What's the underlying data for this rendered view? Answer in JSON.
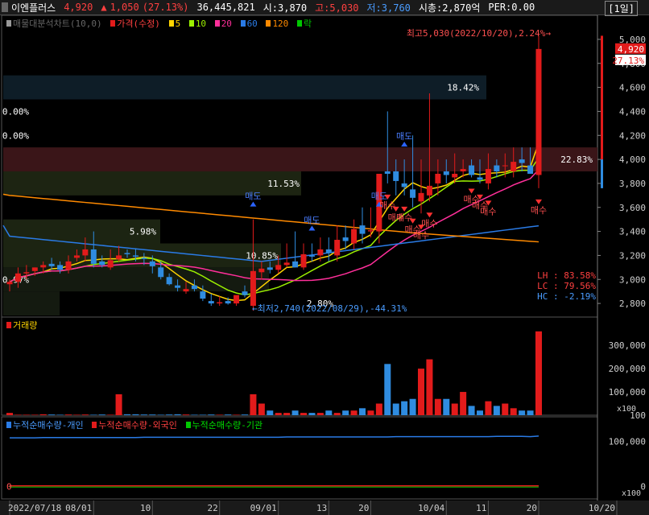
{
  "header": {
    "name": "이엔플러스",
    "price": "4,920",
    "change_arrow": "▲",
    "change": "1,050",
    "change_pct": "(27.13%)",
    "volume": "36,445,821",
    "open": "시:3,870",
    "high": "고:5,030",
    "low": "저:3,760",
    "mcap": "시총:2,870억",
    "per": "PER:0.00",
    "timeframe": "[1일]"
  },
  "price_legend": {
    "profile": "매물대분석차트(10,0)",
    "price_label": "가격(수정)",
    "ma": [
      "5",
      "10",
      "20",
      "60",
      "120",
      "락"
    ]
  },
  "volume_legend": "거래량",
  "flow_legend": [
    "누적순매수량-개인",
    "누적순매수량-외국인",
    "누적순매수량-기관"
  ],
  "annotations": {
    "high": "최고5,030(2022/10/20),2.24%→",
    "low": "←최저2,740(2022/08/29),-44.31%",
    "lh": "LH : 83.58%",
    "lc": "LC : 79.56%",
    "hc": "HC : -2.19%",
    "current_price": "4,920",
    "current_pct": "27.13%",
    "flow_zero": "0",
    "flow_unit": "x100",
    "vol_unit": "x100",
    "buy": "매수",
    "sell": "매도"
  },
  "profile_zones": [
    {
      "low": 4500,
      "high": 4700,
      "pct": "18.42%"
    },
    {
      "low": 4100,
      "high": 4300,
      "pct": "0.00%"
    },
    {
      "low": 4300,
      "high": 4500,
      "pct": "0.00%"
    },
    {
      "low": 3700,
      "high": 3900,
      "pct": "11.53%"
    },
    {
      "low": 3900,
      "high": 4100,
      "pct": "22.83%"
    },
    {
      "low": 3300,
      "high": 3500,
      "pct": "5.98%"
    },
    {
      "low": 3100,
      "high": 3300,
      "pct": "10.85%"
    },
    {
      "low": 2900,
      "high": 3100,
      "pct": "0.97%"
    },
    {
      "low": 2700,
      "high": 2900,
      "pct": "2.80%"
    }
  ],
  "chart_data": {
    "type": "candlestick",
    "dates": [
      "2022/07/18",
      "2022/07/19",
      "2022/07/20",
      "2022/07/21",
      "2022/07/22",
      "2022/07/25",
      "2022/07/26",
      "2022/07/27",
      "2022/07/28",
      "2022/07/29",
      "2022/08/01",
      "2022/08/02",
      "2022/08/03",
      "2022/08/04",
      "2022/08/05",
      "2022/08/08",
      "2022/08/09",
      "2022/08/10",
      "2022/08/11",
      "2022/08/12",
      "2022/08/16",
      "2022/08/17",
      "2022/08/18",
      "2022/08/19",
      "2022/08/22",
      "2022/08/23",
      "2022/08/24",
      "2022/08/25",
      "2022/08/26",
      "2022/08/29",
      "2022/08/30",
      "2022/08/31",
      "2022/09/01",
      "2022/09/02",
      "2022/09/05",
      "2022/09/06",
      "2022/09/07",
      "2022/09/08",
      "2022/09/13",
      "2022/09/14",
      "2022/09/15",
      "2022/09/16",
      "2022/09/19",
      "2022/09/20",
      "2022/09/21",
      "2022/09/22",
      "2022/09/23",
      "2022/09/26",
      "2022/09/27",
      "2022/09/28",
      "2022/09/29",
      "2022/09/30",
      "2022/10/04",
      "2022/10/05",
      "2022/10/06",
      "2022/10/07",
      "2022/10/11",
      "2022/10/12",
      "2022/10/13",
      "2022/10/14",
      "2022/10/17",
      "2022/10/18",
      "2022/10/19",
      "2022/10/20"
    ],
    "open": [
      2960,
      2980,
      3050,
      3070,
      3100,
      3130,
      3120,
      3080,
      3180,
      3200,
      3250,
      3150,
      3100,
      3170,
      3220,
      3200,
      3180,
      3150,
      3100,
      3020,
      2950,
      2900,
      2950,
      2900,
      2820,
      2800,
      2820,
      2800,
      2900,
      2780,
      3060,
      3100,
      3080,
      3120,
      3150,
      3100,
      3200,
      3200,
      3250,
      3200,
      3350,
      3300,
      3450,
      3400,
      3400,
      3900,
      3900,
      3800,
      3750,
      3650,
      3700,
      3800,
      3900,
      3850,
      3900,
      3950,
      3850,
      3800,
      3950,
      3950,
      3900,
      4000,
      3950,
      3870
    ],
    "high": [
      3000,
      3100,
      3120,
      3100,
      3150,
      3180,
      3150,
      3200,
      3250,
      3350,
      3400,
      3200,
      3250,
      3280,
      3250,
      3260,
      3220,
      3200,
      3150,
      3050,
      3000,
      2980,
      3000,
      2950,
      2880,
      2860,
      2850,
      2860,
      2950,
      3500,
      3150,
      3150,
      3200,
      3300,
      3400,
      3300,
      3300,
      3350,
      3350,
      3450,
      3450,
      3500,
      3600,
      3600,
      3500,
      4400,
      4000,
      4000,
      4200,
      4000,
      4550,
      4000,
      4000,
      4050,
      4000,
      4000,
      4000,
      4050,
      4000,
      4050,
      4100,
      4100,
      4100,
      5030
    ],
    "low": [
      2900,
      2930,
      3000,
      3030,
      3050,
      3080,
      3050,
      3050,
      3150,
      3150,
      3100,
      3100,
      3080,
      3150,
      3180,
      3150,
      3120,
      3050,
      3000,
      2950,
      2900,
      2880,
      2900,
      2820,
      2780,
      2780,
      2790,
      2780,
      2850,
      2740,
      3000,
      3050,
      3050,
      3100,
      3100,
      3080,
      3150,
      3150,
      3150,
      3150,
      3250,
      3250,
      3300,
      3350,
      3300,
      3800,
      3700,
      3700,
      3600,
      3550,
      3650,
      3700,
      3800,
      3800,
      3850,
      3850,
      3800,
      3750,
      3850,
      3850,
      3850,
      3900,
      3900,
      3760
    ],
    "close": [
      2980,
      3050,
      3060,
      3100,
      3120,
      3110,
      3080,
      3150,
      3200,
      3250,
      3130,
      3120,
      3160,
      3200,
      3210,
      3190,
      3170,
      3110,
      3020,
      2960,
      2930,
      2920,
      2920,
      2840,
      2800,
      2810,
      2800,
      2870,
      2870,
      3070,
      3090,
      3080,
      3120,
      3140,
      3100,
      3210,
      3190,
      3250,
      3220,
      3330,
      3320,
      3420,
      3380,
      3410,
      3880,
      3880,
      3820,
      3770,
      3680,
      3720,
      3780,
      3880,
      3870,
      3880,
      3920,
      3870,
      3830,
      3920,
      3900,
      3950,
      3980,
      3970,
      3880,
      4920
    ],
    "volume": [
      100,
      20,
      20,
      20,
      40,
      30,
      20,
      30,
      20,
      30,
      20,
      30,
      20,
      900,
      40,
      40,
      30,
      30,
      20,
      30,
      40,
      30,
      20,
      20,
      30,
      20,
      30,
      20,
      30,
      900,
      500,
      200,
      100,
      100,
      200,
      100,
      100,
      100,
      200,
      100,
      200,
      200,
      300,
      200,
      500,
      2200,
      500,
      600,
      700,
      2000,
      2400,
      700,
      700,
      500,
      1000,
      400,
      200,
      600,
      400,
      500,
      300,
      200,
      200,
      3600
    ],
    "flow_individual": [
      162,
      162,
      162,
      162,
      163,
      163,
      163,
      163,
      163,
      163,
      163,
      163,
      163,
      163,
      163,
      163,
      164,
      164,
      164,
      164,
      164,
      164,
      164,
      164,
      164,
      164,
      164,
      164,
      164,
      164,
      164,
      164,
      164,
      165,
      165,
      165,
      165,
      165,
      165,
      165,
      165,
      165,
      165,
      165,
      165,
      165,
      166,
      166,
      166,
      166,
      166,
      166,
      166,
      166,
      166,
      166,
      166,
      166,
      167,
      167,
      167,
      167,
      166,
      168
    ],
    "flow_foreign": [
      2,
      2,
      2,
      2,
      2,
      2,
      2,
      2,
      2,
      2,
      2,
      2,
      2,
      2,
      2,
      2,
      2,
      2,
      2,
      2,
      2,
      2,
      2,
      2,
      2,
      2,
      2,
      2,
      2,
      2,
      2,
      2,
      2,
      2,
      2,
      2,
      2,
      2,
      2,
      2,
      2,
      2,
      2,
      2,
      2,
      2,
      2,
      2,
      2,
      2,
      2,
      2,
      2,
      2,
      2,
      2,
      2,
      2,
      2,
      2,
      2,
      2,
      2,
      2
    ],
    "flow_institution": [
      0,
      0,
      0,
      0,
      0,
      0,
      0,
      0,
      0,
      0,
      0,
      0,
      0,
      0,
      0,
      0,
      0,
      0,
      0,
      0,
      0,
      0,
      0,
      0,
      0,
      0,
      0,
      0,
      0,
      0,
      0,
      0,
      0,
      0,
      0,
      0,
      0,
      0,
      0,
      0,
      0,
      0,
      0,
      0,
      0,
      0,
      0,
      0,
      0,
      0,
      0,
      0,
      0,
      0,
      0,
      0,
      0,
      0,
      0,
      0,
      0,
      0,
      0,
      0
    ],
    "price_axis": {
      "ylim": [
        2700,
        5100
      ],
      "ticks": [
        "5,000",
        "4,800",
        "4,600",
        "4,400",
        "4,200",
        "4,000",
        "3,800",
        "3,600",
        "3,400",
        "3,200",
        "3,000",
        "2,800"
      ]
    },
    "volume_axis": {
      "ylim": [
        0,
        3800
      ],
      "ticks": [
        "300,000",
        "200,000",
        "100,000",
        "100"
      ]
    },
    "flow_axis": {
      "ylim": [
        -20,
        200
      ],
      "ticks": [
        "100,000",
        "0"
      ]
    },
    "x_ticks": [
      {
        "index": 0,
        "label": "2022/07/18"
      },
      {
        "index": 10,
        "label": "08/01"
      },
      {
        "index": 17,
        "label": "10"
      },
      {
        "index": 25,
        "label": "22"
      },
      {
        "index": 32,
        "label": "09/01"
      },
      {
        "index": 38,
        "label": "13"
      },
      {
        "index": 43,
        "label": "20"
      },
      {
        "index": 52,
        "label": "10/04"
      },
      {
        "index": 57,
        "label": "11"
      },
      {
        "index": 63,
        "label": "20"
      },
      {
        "index": 70,
        "label": "10/20"
      }
    ],
    "signals": [
      {
        "index": 29,
        "type": "sell"
      },
      {
        "index": 36,
        "type": "sell"
      },
      {
        "index": 44,
        "type": "sell"
      },
      {
        "index": 47,
        "type": "sell"
      },
      {
        "index": 45,
        "type": "buy"
      },
      {
        "index": 46,
        "type": "buy"
      },
      {
        "index": 47,
        "type": "buy"
      },
      {
        "index": 48,
        "type": "buy"
      },
      {
        "index": 49,
        "type": "buy"
      },
      {
        "index": 50,
        "type": "buy"
      },
      {
        "index": 55,
        "type": "buy"
      },
      {
        "index": 56,
        "type": "buy"
      },
      {
        "index": 57,
        "type": "buy"
      },
      {
        "index": 63,
        "type": "buy"
      }
    ]
  },
  "colors": {
    "up": "#e21b1b",
    "down": "#2f8ce0",
    "ma5": "#ffd400",
    "ma10": "#9cf000",
    "ma20": "#ff2f9a",
    "ma60": "#2a7be6",
    "ma120": "#ff8a00",
    "ma_lock": "#00c800",
    "grid": "#3a3a3a",
    "axis_text": "#cfcfcf"
  }
}
